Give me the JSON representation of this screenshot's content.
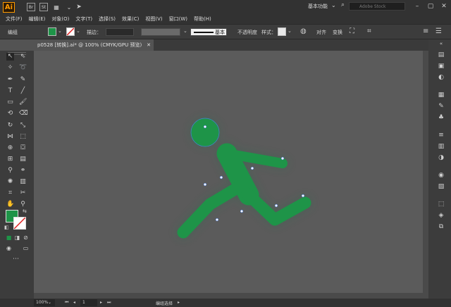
{
  "app": {
    "logo": "Ai",
    "bridge_label": "Br",
    "stock_label": "St",
    "workspace": "基本功能",
    "search_placeholder": "Adobe Stock",
    "menu": [
      "文件(F)",
      "编辑(E)",
      "对象(O)",
      "文字(T)",
      "选择(S)",
      "效果(C)",
      "视图(V)",
      "窗口(W)",
      "帮助(H)"
    ]
  },
  "controlbar": {
    "selection_label": "编组",
    "fill_color": "#1e9448",
    "stroke_label": "描边：",
    "stroke_style": "基本",
    "opacity_label": "不透明度",
    "style_label": "样式：",
    "align_label": "对齐",
    "transform_label": "变换"
  },
  "document": {
    "tab_title": "p0528 [转换].ai* @ 100% (CMYK/GPU 预览)"
  },
  "toolbar": {
    "fill_color": "#1e9448"
  },
  "artwork": {
    "figure_color": "#1e9448",
    "anchor_color": "#4b7bd6"
  },
  "status": {
    "zoom": "100%",
    "page": "1",
    "tool_name": "编组选择"
  }
}
